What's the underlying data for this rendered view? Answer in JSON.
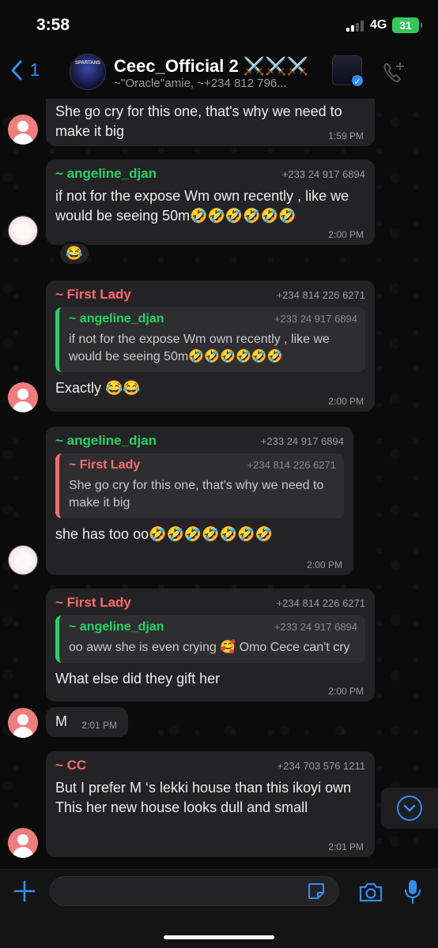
{
  "status_bar": {
    "time": "3:58",
    "network": "4G",
    "battery": "31"
  },
  "header": {
    "back_count": "1",
    "group_avatar_text": "SPARTANS",
    "group_name": "Ceec_Official 2 ⚔️⚔️⚔️",
    "participants": "~''Oracle''amie, ~+234 812 796..."
  },
  "messages": [
    {
      "text": "She go cry for this one, that's why we need to make it big",
      "time": "1:59 PM"
    },
    {
      "sender": "~ angeline_djan",
      "phone": "+233 24 917 6894",
      "text": "if not for the expose Wm own recently , like we would be seeing 50m🤣🤣🤣🤣🤣🤣",
      "time": "2:00 PM",
      "reaction": "😂"
    },
    {
      "sender": "~ First Lady",
      "phone": "+234 814 226 6271",
      "quote": {
        "sender": "~ angeline_djan",
        "phone": "+233 24 917 6894",
        "text": "if not for the expose Wm own recently , like we would be seeing 50m🤣🤣🤣🤣🤣🤣"
      },
      "text": "Exactly 😂😂",
      "time": "2:00 PM"
    },
    {
      "sender": "~ angeline_djan",
      "phone": "+233 24 917 6894",
      "quote": {
        "sender": "~ First Lady",
        "phone": "+234 814 226 6271",
        "text": "She go cry for this one, that's why we need to make it big"
      },
      "text": "she has too oo🤣🤣🤣🤣🤣🤣🤣",
      "time": "2:00 PM"
    },
    {
      "sender": "~ First Lady",
      "phone": "+234 814 226 6271",
      "quote": {
        "sender": "~ angeline_djan",
        "phone": "+233 24 917 6894",
        "text": "oo aww she is even crying 🥰 Omo Cece can't cry"
      },
      "text": "What else did they gift her",
      "time": "2:00 PM"
    },
    {
      "text": "M",
      "time": "2:01 PM"
    },
    {
      "sender": "~ CC",
      "phone": "+234 703 576 1211",
      "text": "But I prefer M ‘s lekki house than this ikoyi own\nThis her new house looks dull and small",
      "time": "2:01 PM"
    }
  ],
  "input": {
    "placeholder": ""
  },
  "colors": {
    "accent": "#2f8ff6",
    "green_name": "#25d366",
    "pink_name": "#ff6b6b",
    "bubble": "#232325"
  },
  "icons": [
    "back-chevron-icon",
    "verified-icon",
    "add-call-icon",
    "plus-icon",
    "sticker-icon",
    "camera-icon",
    "mic-icon",
    "scroll-down-icon"
  ]
}
